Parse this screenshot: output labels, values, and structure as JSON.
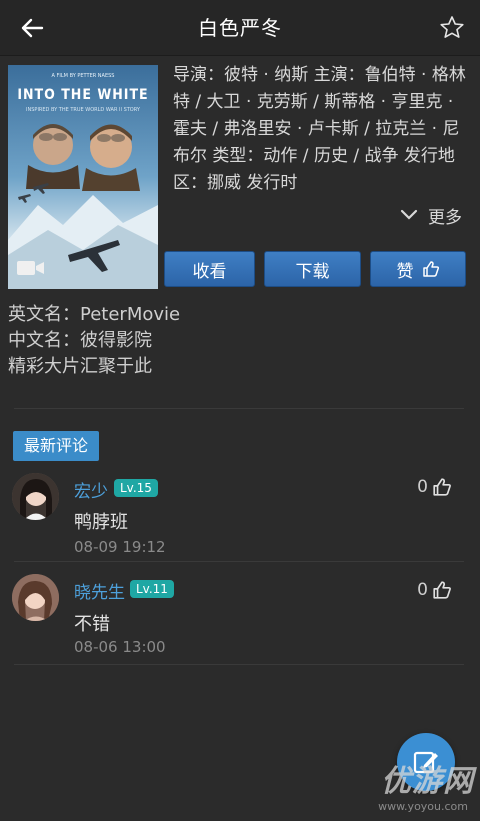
{
  "header": {
    "title": "白色严冬"
  },
  "poster": {
    "tagline": "A FILM BY PETTER NAESS",
    "title": "INTO THE WHITE",
    "subtitle": "INSPIRED BY THE TRUE WORLD WAR II STORY"
  },
  "info": {
    "text": "导演：彼特 · 纳斯 主演：鲁伯特 · 格林特 / 大卫 · 克劳斯 / 斯蒂格 · 亨里克 · 霍夫 / 弗洛里安 · 卢卡斯 / 拉克兰 · 尼布尔 类型：动作 / 历史 / 战争 发行地区：挪威 发行时",
    "more_label": "更多"
  },
  "buttons": {
    "favorite": "收看",
    "download": "下载",
    "like": "赞"
  },
  "description": {
    "english_name": "英文名：PeterMovie",
    "chinese_name": "中文名：彼得影院",
    "slogan": "精彩大片汇聚于此"
  },
  "comments_section": {
    "label": "最新评论"
  },
  "comments": [
    {
      "user": "宏少",
      "level": "Lv.15",
      "text": "鸭脖班",
      "time": "08-09 19:12",
      "likes": "0"
    },
    {
      "user": "晓先生",
      "level": "Lv.11",
      "text": "不错",
      "time": "08-06 13:00",
      "likes": "0"
    }
  ],
  "watermark": {
    "main": "优游网",
    "sub": "www.yoyou.com"
  },
  "colors": {
    "accent": "#3b8cc9",
    "background": "#2b2b2b",
    "level_badge": "#1fa7a4",
    "username": "#4da0db"
  }
}
